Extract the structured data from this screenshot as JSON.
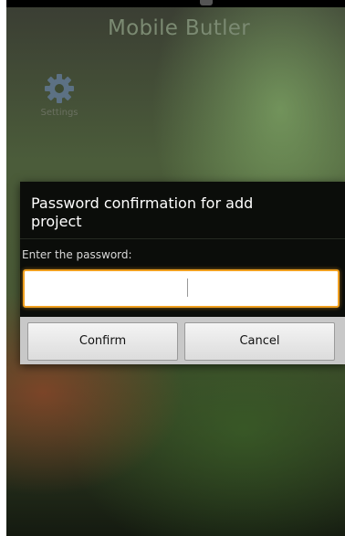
{
  "app": {
    "title": "Mobile Butler"
  },
  "home": {
    "settings_label": "Settings",
    "settings_icon": "gear-icon"
  },
  "dialog": {
    "title": "Password confirmation for add project",
    "prompt": "Enter the password:",
    "password_value": "",
    "confirm_label": "Confirm",
    "cancel_label": "Cancel"
  },
  "colors": {
    "accent_focus": "#f0a020",
    "dialog_bg": "#0b0d0a",
    "title_text": "#7b8a72"
  }
}
